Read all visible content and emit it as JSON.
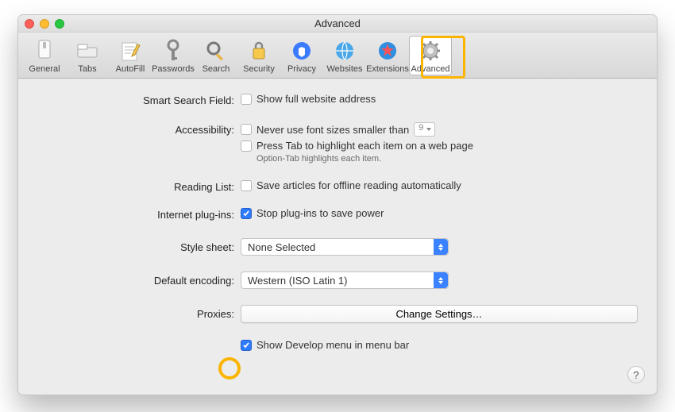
{
  "window": {
    "title": "Advanced"
  },
  "toolbar": {
    "items": [
      {
        "label": "General"
      },
      {
        "label": "Tabs"
      },
      {
        "label": "AutoFill"
      },
      {
        "label": "Passwords"
      },
      {
        "label": "Search"
      },
      {
        "label": "Security"
      },
      {
        "label": "Privacy"
      },
      {
        "label": "Websites"
      },
      {
        "label": "Extensions"
      },
      {
        "label": "Advanced"
      }
    ]
  },
  "form": {
    "smart_search": {
      "label": "Smart Search Field:",
      "show_full_address": "Show full website address"
    },
    "accessibility": {
      "label": "Accessibility:",
      "never_smaller": "Never use font sizes smaller than",
      "font_size_value": "9",
      "press_tab": "Press Tab to highlight each item on a web page",
      "option_hint": "Option-Tab highlights each item."
    },
    "reading_list": {
      "label": "Reading List:",
      "save_offline": "Save articles for offline reading automatically"
    },
    "plugins": {
      "label": "Internet plug-ins:",
      "stop_plugins": "Stop plug-ins to save power"
    },
    "stylesheet": {
      "label": "Style sheet:",
      "value": "None Selected"
    },
    "encoding": {
      "label": "Default encoding:",
      "value": "Western (ISO Latin 1)"
    },
    "proxies": {
      "label": "Proxies:",
      "button": "Change Settings…"
    },
    "develop": {
      "label": "Show Develop menu in menu bar"
    },
    "help": "?"
  }
}
